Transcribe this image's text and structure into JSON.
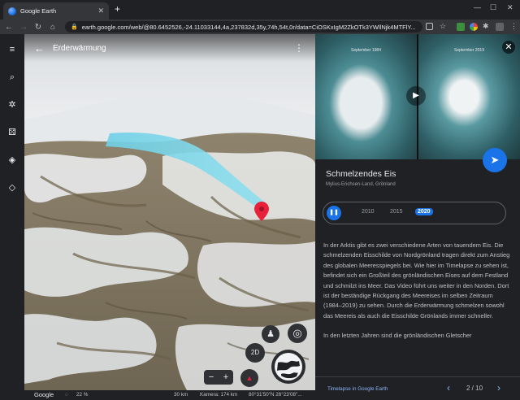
{
  "browser": {
    "tab_title": "Google Earth",
    "tab_close": "✕",
    "new_tab": "+",
    "url": "earth.google.com/web/@80.6452526,-24.11033144,4a,237832d,35y,74h,54t,0r/data=CiOSKxIgM2ZkOTk3YWllNjk4MTFlY...",
    "minimize": "—",
    "maximize": "☐",
    "close": "✕"
  },
  "map": {
    "header_title": "Erderwärmung",
    "btn_2d": "2D",
    "zoom_minus": "−",
    "zoom_plus": "+"
  },
  "statusbar": {
    "brand": "Google",
    "loading": "22 %",
    "scale": "30 km",
    "camera": "Kamera: 174 km",
    "coords": "80°31'50\"N 26°23'08\"..."
  },
  "panel": {
    "video_left_caption": "September 1984",
    "video_right_caption": "September 2019",
    "title": "Schmelzendes Eis",
    "subtitle": "Mylius-Erichsen-Land, Grönland",
    "timeline_years": [
      "2010",
      "2015",
      "2020"
    ],
    "selected_year": "2020",
    "paragraph1": "In der Arktis gibt es zwei verschiedene Arten von tauendem Eis. Die schmelzenden Eisschilde von Nordgrönland tragen direkt zum Anstieg des globalen Meeresspiegels bei. Wie hier im Timelapse zu sehen ist, befindet sich ein Großteil des grönländischen Eises auf dem Festland und schmilzt ins Meer. Das Video führt uns weiter in den Norden. Dort ist der beständige Rückgang des Meereises im selben Zeitraum (1984–2019) zu sehen. Durch die Erderwärmung schmelzen sowohl das Meereis als auch die Eisschilde Grönlands immer schneller.",
    "paragraph2": "In den letzten Jahren sind die grönländischen Gletscher",
    "footer_link": "Timelapse in Google Earth",
    "page_indicator": "2 / 10"
  }
}
